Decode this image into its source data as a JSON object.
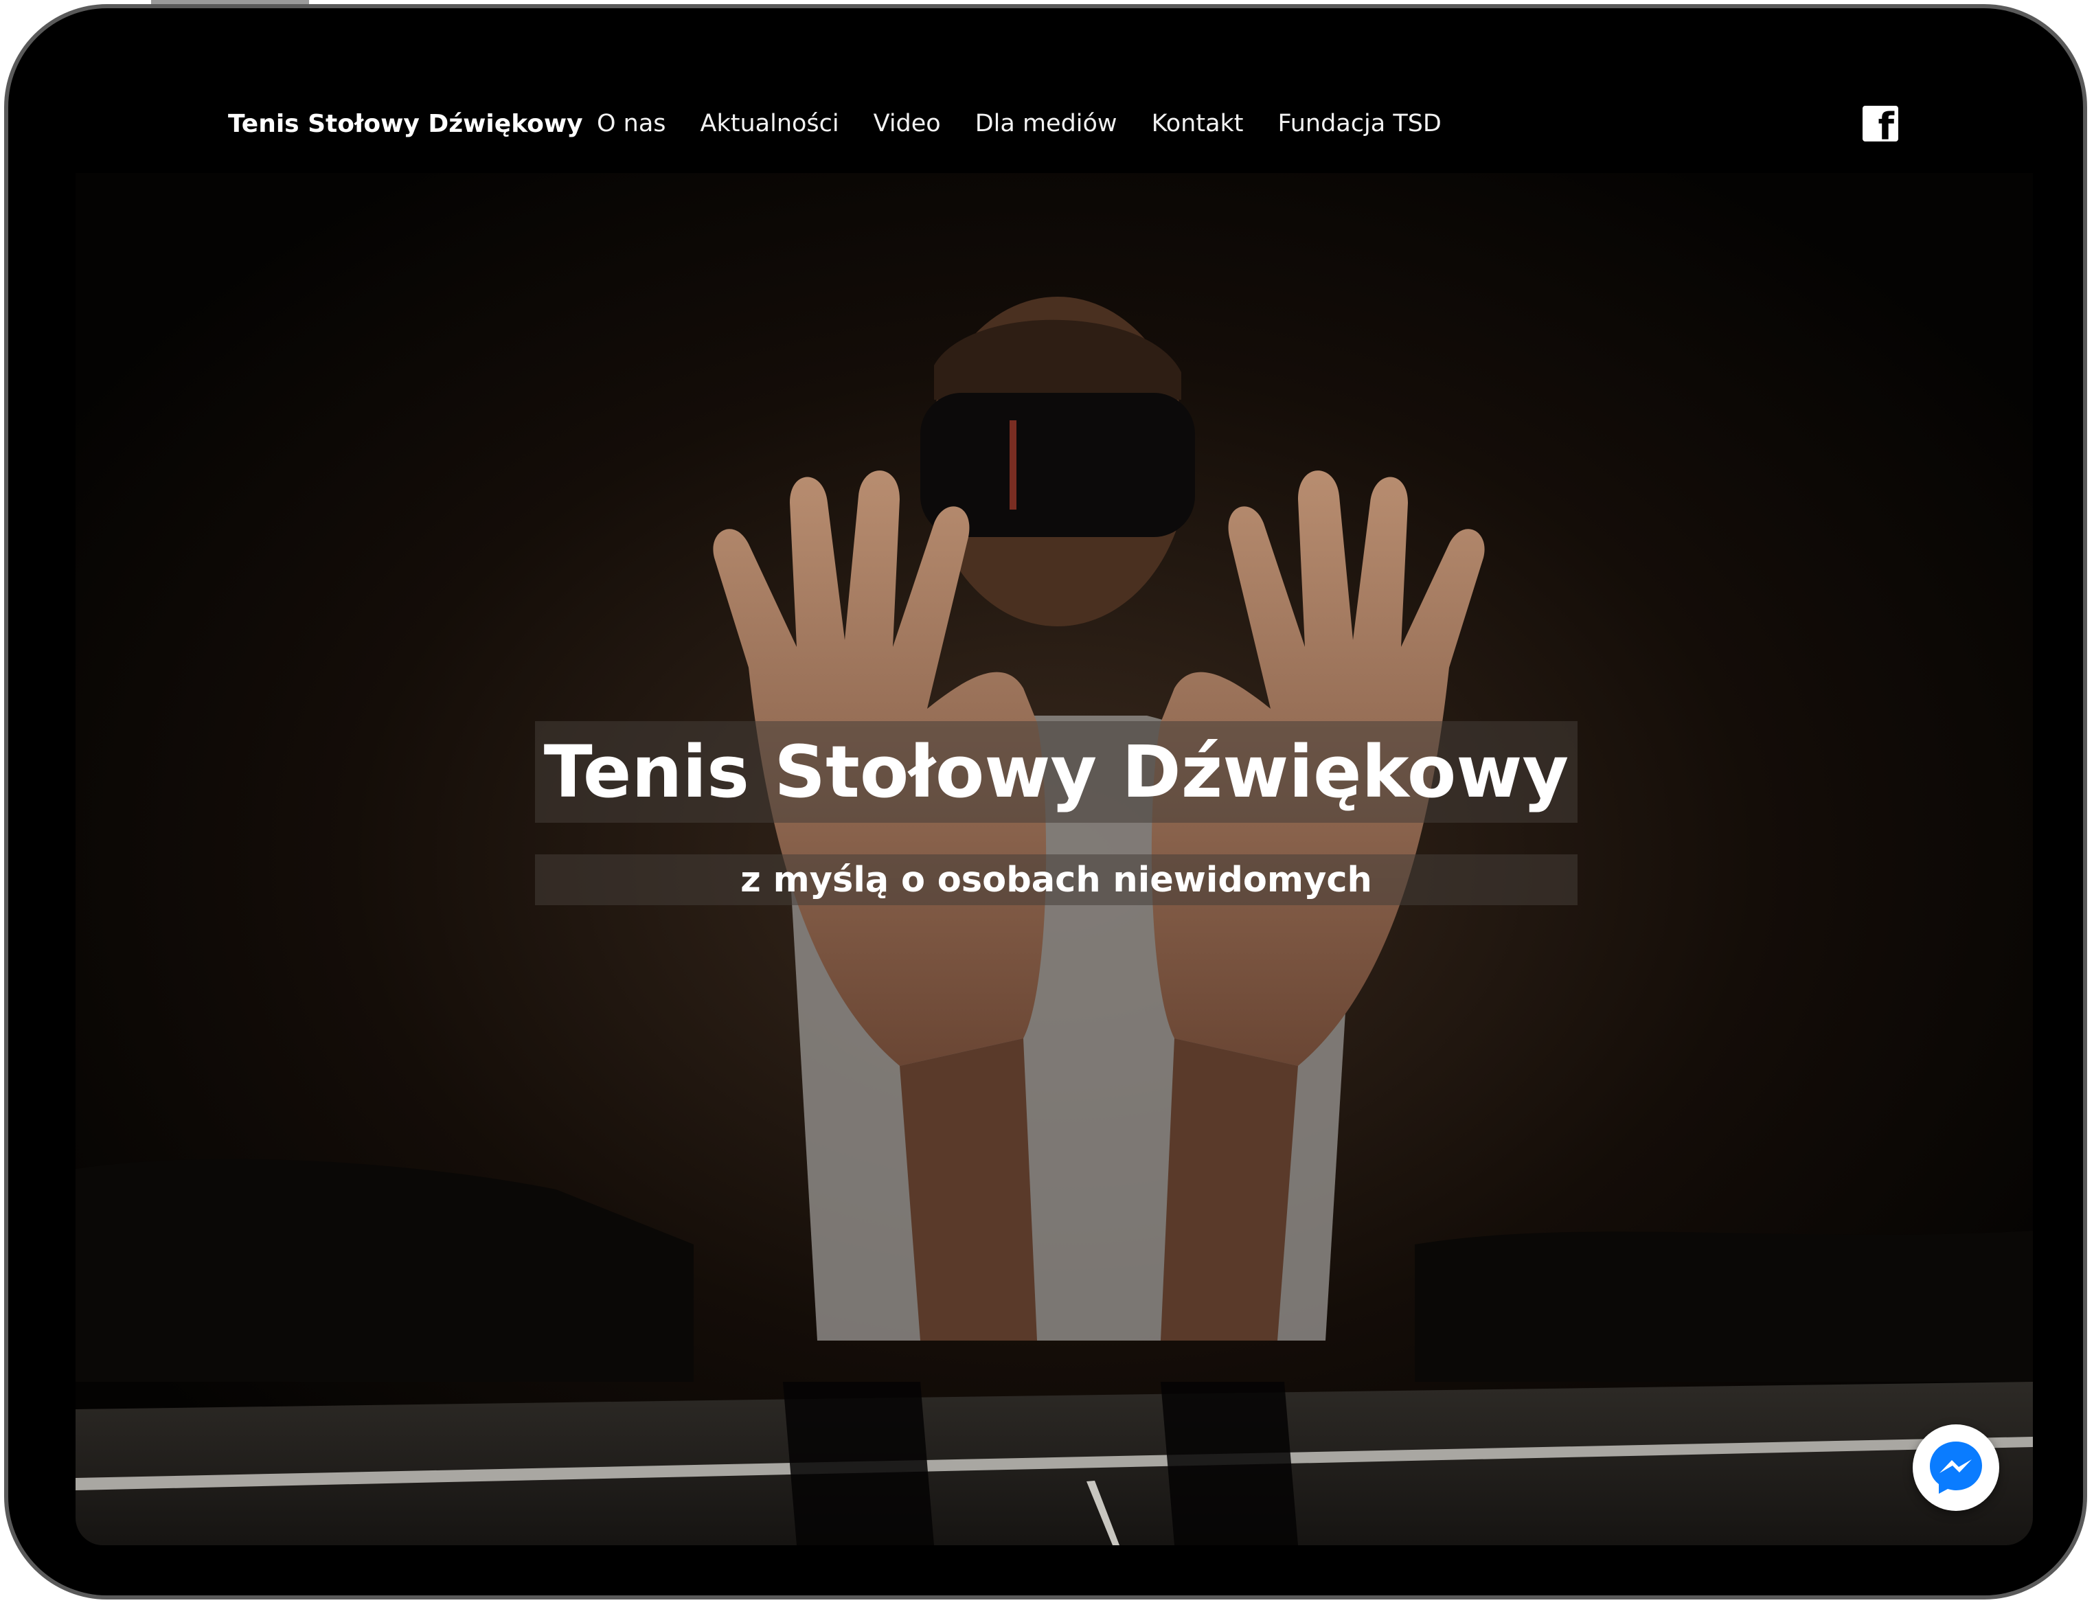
{
  "header": {
    "brand": "Tenis Stołowy Dźwiękowy",
    "nav": [
      "O nas",
      "Aktualności",
      "Video",
      "Dla mediów",
      "Kontakt",
      "Fundacja TSD"
    ],
    "social": {
      "icon": "facebook-icon",
      "label": "f"
    }
  },
  "hero": {
    "title": "Tenis Stołowy Dźwiękowy",
    "subtitle": "z myślą o osobach niewidomych",
    "background": "photo-blindfolded-player-raising-hands-at-table"
  },
  "chat": {
    "icon": "messenger-icon"
  },
  "colors": {
    "background": "#000000",
    "text": "#ffffff",
    "overlay": "#463e38",
    "messenger": "#0a7cff"
  }
}
